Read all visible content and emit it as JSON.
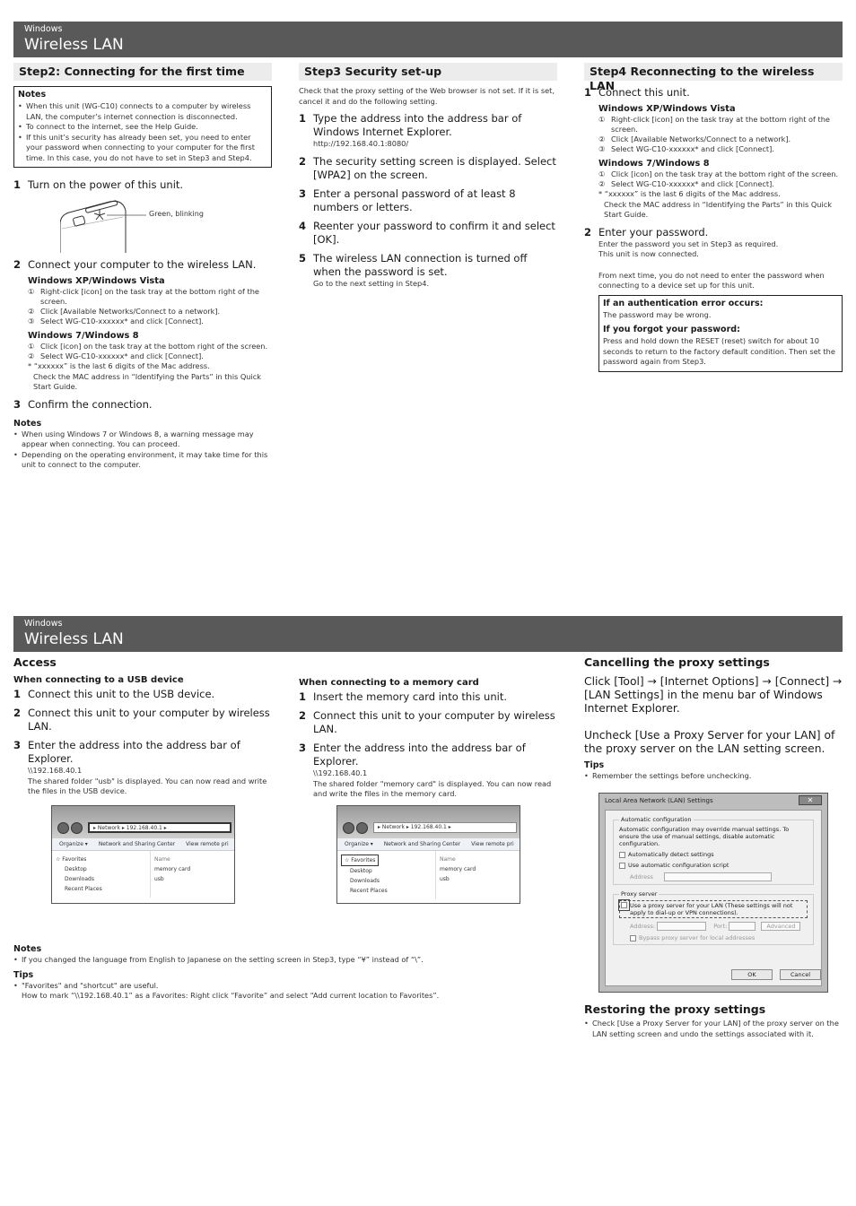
{
  "top": {
    "band": {
      "sup": "Windows",
      "title": "Wireless LAN"
    },
    "step2": {
      "heading": "Step2: Connecting for the first time",
      "notes_title": "Notes",
      "notes": [
        "When this unit (WG-C10) connects to a computer by wireless LAN, the computer’s internet connection is disconnected.",
        "To connect to the internet, see the Help Guide.",
        "If this unit’s security has already been set, you need to enter your password when connecting to your computer for the first time. In this case, you do not have to set in Step3 and Step4."
      ],
      "step1": {
        "num": "1",
        "text": "Turn on the power of this unit."
      },
      "illustration_label": "Green, blinking",
      "step2": {
        "num": "2",
        "text": "Connect your computer to the wireless LAN."
      },
      "xp_title": "Windows XP/Windows Vista",
      "xp_steps": [
        {
          "n": "①",
          "t": "Right-click [icon] on the task tray at the bottom right of the screen."
        },
        {
          "n": "②",
          "t": "Click [Available Networks/Connect to a network]."
        },
        {
          "n": "③",
          "t": "Select WG-C10-xxxxxx* and click [Connect]."
        }
      ],
      "w7_title": "Windows 7/Windows 8",
      "w7_steps": [
        {
          "n": "①",
          "t": "Click [icon] on the task tray at the bottom right of the screen."
        },
        {
          "n": "②",
          "t": "Select WG-C10-xxxxxx* and click [Connect]."
        }
      ],
      "footnote1": "* “xxxxxx” is the last 6 digits of the Mac address.",
      "footnote2": "Check the MAC address in “Identifying the Parts” in this Quick Start Guide.",
      "step3": {
        "num": "3",
        "text": "Confirm the connection."
      },
      "notes2_title": "Notes",
      "notes2": [
        "When using Windows 7 or Windows 8, a warning message may appear when connecting. You can proceed.",
        "Depending on the operating environment, it may take time for this unit to connect to the computer."
      ]
    },
    "step3": {
      "heading": "Step3  Security set-up",
      "intro": "Check that the proxy setting of the Web browser is not set. If it is set, cancel it and do the following setting.",
      "steps": [
        {
          "num": "1",
          "text": "Type the address into the address bar of Windows Internet Explorer.",
          "sub": "http://192.168.40.1:8080/"
        },
        {
          "num": "2",
          "text": "The security setting screen is displayed. Select [WPA2] on the screen.",
          "sub": ""
        },
        {
          "num": "3",
          "text": "Enter a personal password of at least 8 numbers or letters.",
          "sub": ""
        },
        {
          "num": "4",
          "text": "Reenter your password to confirm it and select [OK].",
          "sub": ""
        },
        {
          "num": "5",
          "text": "The wireless LAN connection is turned off when the password is set.",
          "sub": "Go to the next setting in Step4."
        }
      ]
    },
    "step4": {
      "heading": "Step4  Reconnecting to the wireless LAN",
      "step1": {
        "num": "1",
        "text": "Connect this unit."
      },
      "xp_title": "Windows XP/Windows Vista",
      "xp_steps": [
        {
          "n": "①",
          "t": "Right-click [icon] on the task tray at the bottom right of the screen."
        },
        {
          "n": "②",
          "t": "Click [Available Networks/Connect to a network]."
        },
        {
          "n": "③",
          "t": "Select WG-C10-xxxxxx* and click [Connect]."
        }
      ],
      "w7_title": "Windows 7/Windows 8",
      "w7_steps": [
        {
          "n": "①",
          "t": "Click [icon] on the task tray at the bottom right of the screen."
        },
        {
          "n": "②",
          "t": "Select WG-C10-xxxxxx* and click [Connect]."
        }
      ],
      "footnote1": "* “xxxxxx” is the last 6 digits of the Mac address.",
      "footnote2": "Check the MAC address in “Identifying the Parts” in this Quick Start Guide.",
      "step2": {
        "num": "2",
        "text": "Enter your password."
      },
      "p1": "Enter the password you set in Step3 as required.",
      "p2": "This unit is now connected.",
      "p3": "From next time, you do not need to enter the password when connecting to a device set up for this unit.",
      "box": {
        "h1": "If an authentication error occurs:",
        "t1": "The password may be wrong.",
        "h2": "If you forgot your password:",
        "t2": "Press and hold down the RESET (reset) switch for about 10 seconds to return to the factory default condition. Then set the password again from Step3."
      }
    }
  },
  "bottom": {
    "band": {
      "sup": "Windows",
      "title": "Wireless LAN"
    },
    "access": {
      "title": "Access",
      "usb": {
        "heading": "When connecting to a USB device",
        "steps": [
          {
            "num": "1",
            "text": "Connect this unit to the USB device."
          },
          {
            "num": "2",
            "text": "Connect this unit to your computer by wireless LAN."
          },
          {
            "num": "3",
            "text": "Enter the address into the address bar of Explorer."
          }
        ],
        "addr": "\\\\192.168.40.1",
        "desc": "The shared folder \"usb\" is displayed. You can now read and write the files in the USB device."
      },
      "mem": {
        "heading": "When connecting to a memory card",
        "steps": [
          {
            "num": "1",
            "text": "Insert the memory card into this unit."
          },
          {
            "num": "2",
            "text": "Connect this unit to your computer by wireless LAN."
          },
          {
            "num": "3",
            "text": "Enter the address into the address bar of Explorer."
          }
        ],
        "addr": "\\\\192.168.40.1",
        "desc": "The shared folder \"memory card\" is displayed. You can now read and write the files in the memory card."
      },
      "explorer": {
        "crumb": "▸ Network ▸ 192.168.40.1 ▸",
        "toolbar": [
          "Organize ▾",
          "Network and Sharing Center",
          "View remote pri"
        ],
        "left": [
          "Favorites",
          "Desktop",
          "Downloads",
          "Recent Places"
        ],
        "col_header": "Name",
        "items": [
          "memory card",
          "usb"
        ]
      },
      "notes_title": "Notes",
      "notes": [
        "If you changed the language from English to Japanese on the setting screen in Step3, type “¥” instead of “\\”."
      ],
      "tips_title": "Tips",
      "tips1": "\"Favorites\" and \"shortcut\" are useful.",
      "tips2": "How to mark “\\\\192.168.40.1” as a Favorites: Right click “Favorite” and select “Add current location to Favorites”."
    },
    "proxy": {
      "title": "Cancelling the proxy settings",
      "p1": "Click [Tool] → [Internet Options] → [Connect] → [LAN Settings] in the menu bar of Windows Internet Explorer.",
      "p2": "Uncheck [Use a Proxy Server for your LAN] of the proxy server on the LAN setting screen.",
      "tips_title": "Tips",
      "tips": "Remember the settings before unchecking.",
      "dialog": {
        "title": "Local Area Network (LAN) Settings",
        "close": "✕",
        "auto_legend": "Automatic configuration",
        "auto_desc": "Automatic configuration may override manual settings.  To ensure the use of manual settings, disable automatic configuration.",
        "auto_detect": "Automatically detect settings",
        "auto_script": "Use automatic configuration script",
        "address_label": "Address",
        "proxy_legend": "Proxy server",
        "proxy_use": "Use a proxy server for your LAN (These settings will not apply to dial-up or VPN connections).",
        "proxy_addr_label": "Address:",
        "port_label": "Port:",
        "advanced": "Advanced",
        "bypass": "Bypass proxy server for local addresses",
        "ok": "OK",
        "cancel": "Cancel"
      },
      "restore_title": "Restoring the proxy settings",
      "restore": "Check [Use a Proxy Server for your LAN] of the proxy server on the LAN setting screen and undo the settings associated with it."
    }
  }
}
